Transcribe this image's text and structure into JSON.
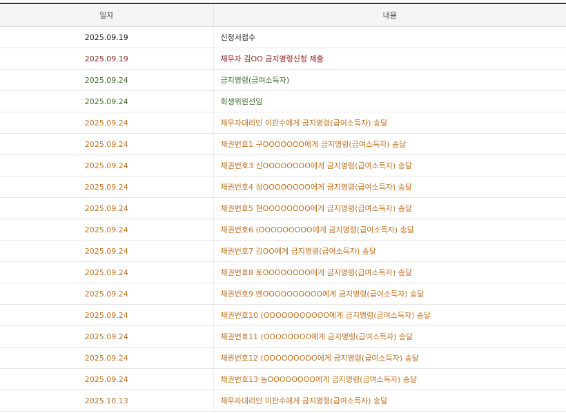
{
  "table": {
    "headers": {
      "date": "일자",
      "content": "내용"
    },
    "rows": [
      {
        "date": "2025.09.19",
        "content": "신청서접수",
        "status": "black"
      },
      {
        "date": "2025.09.19",
        "content": "채무자 김OO 금지명령신청 제출",
        "status": "red"
      },
      {
        "date": "2025.09.24",
        "content": "금지명령(급여소득자)",
        "status": "green"
      },
      {
        "date": "2025.09.24",
        "content": "회생위원선임",
        "status": "green"
      },
      {
        "date": "2025.09.24",
        "content": "채무자대리인 이판수에게 금지명령(급여소득자) 송달",
        "status": "orange"
      },
      {
        "date": "2025.09.24",
        "content": "채권번호1 구OOOOOOO에게 금지명령(급여소득자) 송달",
        "status": "orange"
      },
      {
        "date": "2025.09.24",
        "content": "채권번호3 신OOOOOOOO에게 금지명령(급여소득자) 송달",
        "status": "orange"
      },
      {
        "date": "2025.09.24",
        "content": "채권번호4 삼OOOOOOOO에게 금지명령(급여소득자) 송달",
        "status": "orange"
      },
      {
        "date": "2025.09.24",
        "content": "채권번호5 현OOOOOOOO에게 금지명령(급여소득자) 송달",
        "status": "orange"
      },
      {
        "date": "2025.09.24",
        "content": "채권번호6 (OOOOOOOOO에게 금지명령(급여소득자) 송달",
        "status": "orange"
      },
      {
        "date": "2025.09.24",
        "content": "채권번호7 김OO에게 금지명령(급여소득자) 송달",
        "status": "orange"
      },
      {
        "date": "2025.09.24",
        "content": "채권번호8 토OOOOOOOO에게 금지명령(급여소득자) 송달",
        "status": "orange"
      },
      {
        "date": "2025.09.24",
        "content": "채권번호9 엔OOOOOOOOOO에게 금지명령(급여소득자) 송달",
        "status": "orange"
      },
      {
        "date": "2025.09.24",
        "content": "채권번호10 (OOOOOOOOOOO에게 금지명령(급여소득자) 송달",
        "status": "orange"
      },
      {
        "date": "2025.09.24",
        "content": "채권번호11 (OOOOOOOO에게 금지명령(급여소득자) 송달",
        "status": "orange"
      },
      {
        "date": "2025.09.24",
        "content": "채권번호12 (OOOOOOOOO에게 금지명령(급여소득자) 송달",
        "status": "orange"
      },
      {
        "date": "2025.09.24",
        "content": "채권번호13 농OOOOOOOO에게 금지명령(급여소득자) 송달",
        "status": "orange"
      },
      {
        "date": "2025.10.13",
        "content": "채무자대리인 이판수에게 금지명령(급여소득자) 송달",
        "status": "orange"
      }
    ]
  },
  "colors": {
    "black": "#1a1a1a",
    "red": "#8a1f1f",
    "green": "#3d6b2a",
    "orange": "#c07020"
  }
}
